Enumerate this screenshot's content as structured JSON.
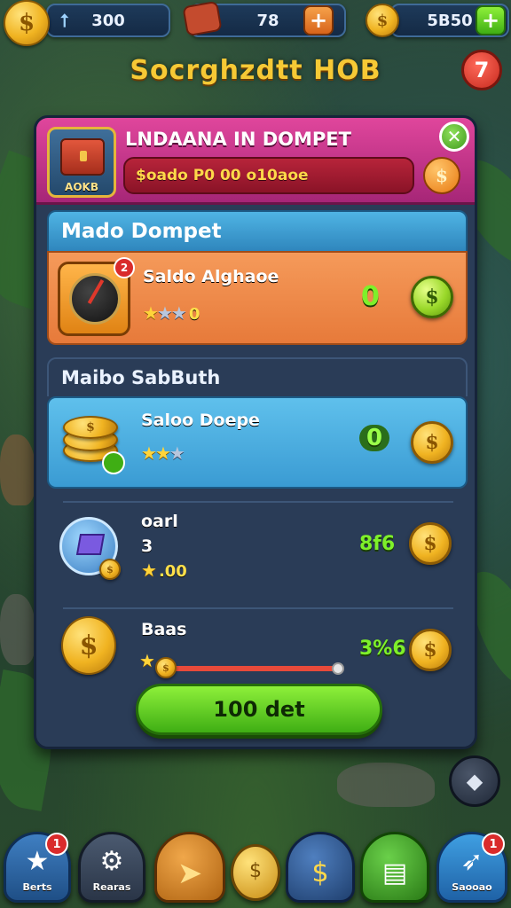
{
  "topbar": {
    "gems": "300",
    "energy": "78",
    "coins": "5B50",
    "gem_icon": "arrow-up-icon",
    "energy_icon": "ticket-icon",
    "coin_glyph": "$",
    "plus_glyph": "+"
  },
  "hub_title": "Socrghzdtt HOB",
  "corner_button_glyph": "7",
  "panel": {
    "title": "LNDAANA IN DOMPET",
    "chest_label": "AOKB",
    "balance_text": "$oado P0 00 o10aoe",
    "close_glyph": "✕",
    "coin_glyph": "$"
  },
  "section1": {
    "heading": "Mado Dompet",
    "item": {
      "title": "Saldo Alghaoe",
      "stars_filled": 1,
      "stars_total": 3,
      "stars_value": "0",
      "price": "0",
      "badge": "2",
      "coin_glyph": "$"
    }
  },
  "section2": {
    "heading": "Maibo SabButh",
    "items": [
      {
        "title": "Saloo Doepe",
        "stars_filled": 2,
        "stars_total": 3,
        "stars_value": "",
        "price": "0",
        "coin_glyph": "$"
      },
      {
        "title": "oarl",
        "subtitle": "3",
        "stars_filled": 1,
        "stars_total": 1,
        "stars_value": ".00",
        "price": "8f6",
        "coin_glyph": "$"
      },
      {
        "title": "Baas",
        "stars_filled": 1,
        "stars_total": 1,
        "stars_value": "",
        "price": "3%6",
        "coin_glyph": "$",
        "slider_value": 1.0
      }
    ]
  },
  "main_button": "100 det",
  "bottom_nav": [
    {
      "label": "Berts",
      "glyph": "★",
      "badge": "1",
      "icon": "star-icon"
    },
    {
      "label": "Rearas",
      "glyph": "⚙",
      "badge": "",
      "icon": "gear-icon"
    },
    {
      "label": "",
      "glyph": "➤",
      "badge": "",
      "icon": "arrow-icon"
    },
    {
      "label": "",
      "glyph": "$",
      "badge": "",
      "icon": "coin-stack-icon"
    },
    {
      "label": "",
      "glyph": "$",
      "badge": "",
      "icon": "coin-icon"
    },
    {
      "label": "",
      "glyph": "▤",
      "badge": "",
      "icon": "card-icon"
    },
    {
      "label": "Saooao",
      "glyph": "➶",
      "badge": "1",
      "icon": "rocket-icon"
    }
  ],
  "colors": {
    "accent_green": "#7ef02a",
    "header_pink": "#c9368b",
    "section1_orange": "#f08a4b",
    "section2_blue": "#3fa8df",
    "gold": "#f0b321"
  }
}
